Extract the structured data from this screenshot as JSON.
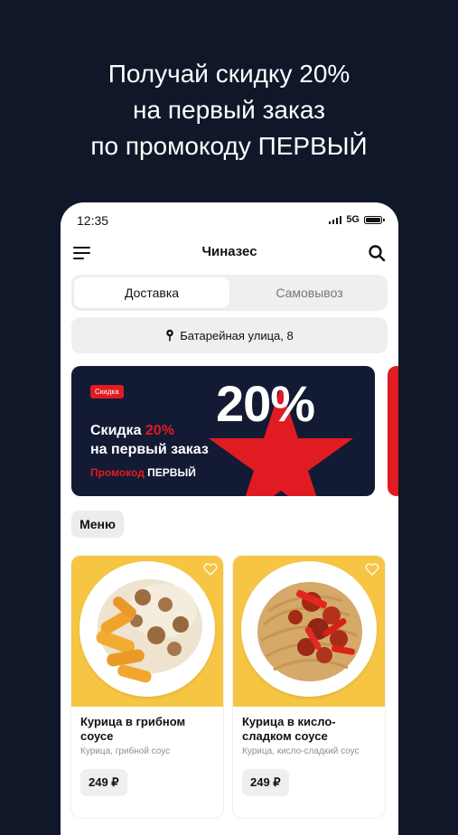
{
  "promo": {
    "line1": "Получай скидку 20%",
    "line2": "на первый заказ",
    "line3": "по промокоду ПЕРВЫЙ"
  },
  "status_bar": {
    "time": "12:35",
    "network": "5G"
  },
  "header": {
    "title": "Чиназес"
  },
  "tabs": [
    {
      "label": "Доставка",
      "active": true
    },
    {
      "label": "Самовывоз",
      "active": false
    }
  ],
  "address": "Батарейная улица, 8",
  "banner": {
    "badge": "Скидка",
    "big_text": "20%",
    "title_part1": "Скидка ",
    "title_highlight": "20%",
    "title_line2": "на первый заказ",
    "code_label": "Промокод",
    "code": "ПЕРВЫЙ"
  },
  "menu_label": "Меню",
  "products": [
    {
      "name": "Курица в грибном соусе",
      "desc": "Курица, грибной соус",
      "price": "249 ₽"
    },
    {
      "name": "Курица в кисло-сладком соусе",
      "desc": "Курица, кисло-сладкий соус",
      "price": "249 ₽"
    }
  ],
  "colors": {
    "background": "#0f1729",
    "accent_red": "#e11b22",
    "banner_bg": "#131a33",
    "card_image_bg": "#f6c543"
  }
}
